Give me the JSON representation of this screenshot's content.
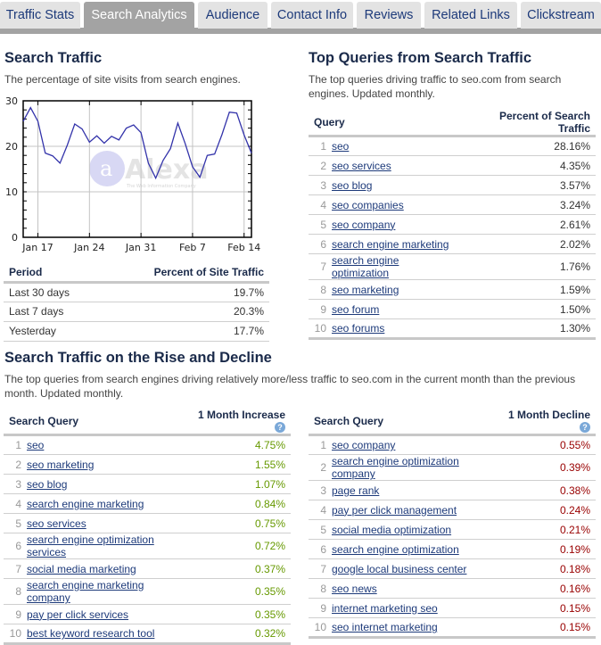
{
  "tabs": [
    {
      "label": "Traffic Stats",
      "active": false
    },
    {
      "label": "Search Analytics",
      "active": true
    },
    {
      "label": "Audience",
      "active": false
    },
    {
      "label": "Contact Info",
      "active": false
    },
    {
      "label": "Reviews",
      "active": false
    },
    {
      "label": "Related Links",
      "active": false
    },
    {
      "label": "Clickstream",
      "active": false
    }
  ],
  "search_traffic": {
    "title": "Search Traffic",
    "description": "The percentage of site visits from search engines.",
    "watermark": "Alexa",
    "watermark_sub": "The Web Information Company",
    "period_table": {
      "headers": [
        "Period",
        "Percent of Site Traffic"
      ],
      "rows": [
        {
          "period": "Last 30 days",
          "value": "19.7%"
        },
        {
          "period": "Last 7 days",
          "value": "20.3%"
        },
        {
          "period": "Yesterday",
          "value": "17.7%"
        }
      ]
    }
  },
  "chart_data": {
    "type": "line",
    "title": "",
    "xlabel": "",
    "ylabel": "",
    "ylim": [
      0,
      30
    ],
    "yticks": [
      0,
      10,
      20,
      30
    ],
    "xtick_labels": [
      "Jan 17",
      "Jan 24",
      "Jan 31",
      "Feb 7",
      "Feb 14"
    ],
    "xtick_day_index": [
      2,
      9,
      16,
      23,
      30
    ],
    "x_range_days": [
      0,
      31
    ],
    "grid": true,
    "line_color": "#3333aa",
    "x": [
      "Jan 15",
      "Jan 16",
      "Jan 17",
      "Jan 18",
      "Jan 19",
      "Jan 20",
      "Jan 21",
      "Jan 22",
      "Jan 23",
      "Jan 24",
      "Jan 25",
      "Jan 26",
      "Jan 27",
      "Jan 28",
      "Jan 29",
      "Jan 30",
      "Jan 31",
      "Feb 1",
      "Feb 2",
      "Feb 3",
      "Feb 4",
      "Feb 5",
      "Feb 6",
      "Feb 7",
      "Feb 8",
      "Feb 9",
      "Feb 10",
      "Feb 11",
      "Feb 12",
      "Feb 13",
      "Feb 14",
      "Feb 15"
    ],
    "series": [
      {
        "name": "Search traffic %",
        "values": [
          25.5,
          28.5,
          25.5,
          18.5,
          17.9,
          16.3,
          20.3,
          24.9,
          23.8,
          20.9,
          22.3,
          20.7,
          22.2,
          21.4,
          24.0,
          24.7,
          23.0,
          16.3,
          13.0,
          16.9,
          19.5,
          25.1,
          20.6,
          15.5,
          13.2,
          18.0,
          18.3,
          22.6,
          27.5,
          27.3,
          22.5,
          18.5
        ]
      }
    ]
  },
  "top_queries": {
    "title": "Top Queries from Search Traffic",
    "description": "The top queries driving traffic to seo.com from search engines. Updated monthly.",
    "headers": [
      "Query",
      "Percent of Search Traffic"
    ],
    "rows": [
      {
        "rank": "1",
        "query": "seo",
        "value": "28.16%"
      },
      {
        "rank": "2",
        "query": "seo services",
        "value": "4.35%"
      },
      {
        "rank": "3",
        "query": "seo blog",
        "value": "3.57%"
      },
      {
        "rank": "4",
        "query": "seo companies",
        "value": "3.24%"
      },
      {
        "rank": "5",
        "query": "seo company",
        "value": "2.61%"
      },
      {
        "rank": "6",
        "query": "search engine marketing",
        "value": "2.02%"
      },
      {
        "rank": "7",
        "query": "search engine optimization",
        "value": "1.76%"
      },
      {
        "rank": "8",
        "query": "seo marketing",
        "value": "1.59%"
      },
      {
        "rank": "9",
        "query": "seo forum",
        "value": "1.50%"
      },
      {
        "rank": "10",
        "query": "seo forums",
        "value": "1.30%"
      }
    ]
  },
  "rise_decline": {
    "title": "Search Traffic on the Rise and Decline",
    "description": "The top queries from search engines driving relatively more/less traffic to seo.com in the current month than the previous month. Updated monthly.",
    "help_icon": "?",
    "increase": {
      "headers": [
        "Search Query",
        "1 Month Increase"
      ],
      "color": "#669900",
      "rows": [
        {
          "rank": "1",
          "query": "seo",
          "value": "4.75%"
        },
        {
          "rank": "2",
          "query": "seo marketing",
          "value": "1.55%"
        },
        {
          "rank": "3",
          "query": "seo blog",
          "value": "1.07%"
        },
        {
          "rank": "4",
          "query": "search engine marketing",
          "value": "0.84%"
        },
        {
          "rank": "5",
          "query": "seo services",
          "value": "0.75%"
        },
        {
          "rank": "6",
          "query": "search engine optimization services",
          "value": "0.72%"
        },
        {
          "rank": "7",
          "query": "social media marketing",
          "value": "0.37%"
        },
        {
          "rank": "8",
          "query": "search engine marketing company",
          "value": "0.35%"
        },
        {
          "rank": "9",
          "query": "pay per click services",
          "value": "0.35%"
        },
        {
          "rank": "10",
          "query": "best keyword research tool",
          "value": "0.32%"
        }
      ]
    },
    "decline": {
      "headers": [
        "Search Query",
        "1 Month Decline"
      ],
      "color": "#990000",
      "rows": [
        {
          "rank": "1",
          "query": "seo company",
          "value": "0.55%"
        },
        {
          "rank": "2",
          "query": "search engine optimization company",
          "value": "0.39%"
        },
        {
          "rank": "3",
          "query": "page rank",
          "value": "0.38%"
        },
        {
          "rank": "4",
          "query": "pay per click management",
          "value": "0.24%"
        },
        {
          "rank": "5",
          "query": "social media optimization",
          "value": "0.21%"
        },
        {
          "rank": "6",
          "query": "search engine optimization",
          "value": "0.19%"
        },
        {
          "rank": "7",
          "query": "google local business center",
          "value": "0.18%"
        },
        {
          "rank": "8",
          "query": "seo news",
          "value": "0.16%"
        },
        {
          "rank": "9",
          "query": "internet marketing seo",
          "value": "0.15%"
        },
        {
          "rank": "10",
          "query": "seo internet marketing",
          "value": "0.15%"
        }
      ]
    }
  }
}
